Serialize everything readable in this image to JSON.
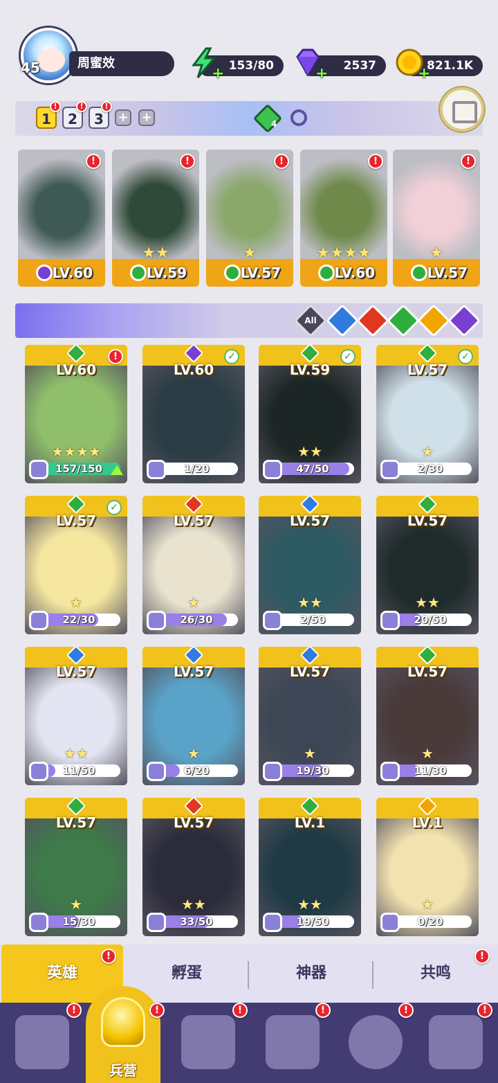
{
  "player": {
    "level": "45",
    "name": "周蜜效"
  },
  "resources": {
    "energy": "153/80",
    "gems": "2537",
    "gold": "821.1K"
  },
  "team_tabs": [
    {
      "label": "1",
      "active": true
    },
    {
      "label": "2",
      "active": false
    },
    {
      "label": "3",
      "active": false
    }
  ],
  "badge_mark": "!",
  "add_symbol": "+",
  "team_gem_count": "4",
  "team_heroes": [
    {
      "level": "LV.60",
      "element": "dark",
      "stars": "",
      "color": "#7a3fd0"
    },
    {
      "level": "LV.59",
      "element": "nature",
      "stars": "★★",
      "color": "#2fae3e"
    },
    {
      "level": "LV.57",
      "element": "nature",
      "stars": "★",
      "color": "#2fae3e"
    },
    {
      "level": "LV.60",
      "element": "nature",
      "stars": "★★★★",
      "color": "#2fae3e"
    },
    {
      "level": "LV.57",
      "element": "nature",
      "stars": "★",
      "color": "#2fae3e"
    }
  ],
  "filter": {
    "all_label": "All",
    "elements": [
      "water",
      "fire",
      "nature",
      "light",
      "dark"
    ]
  },
  "element_colors": {
    "water": "#2f7be0",
    "fire": "#e0381f",
    "nature": "#2fae3e",
    "light": "#f0a500",
    "dark": "#7a3fd0"
  },
  "heroes": [
    {
      "level": "LV.60",
      "element": "nature",
      "progress": "157/150",
      "stars": "★★★★",
      "status": "alert"
    },
    {
      "level": "LV.60",
      "element": "dark",
      "progress": "1/20",
      "stars": "",
      "status": "check"
    },
    {
      "level": "LV.59",
      "element": "nature",
      "progress": "47/50",
      "stars": "★★",
      "status": "check"
    },
    {
      "level": "LV.57",
      "element": "nature",
      "progress": "2/30",
      "stars": "★",
      "status": "check"
    },
    {
      "level": "LV.57",
      "element": "nature",
      "progress": "22/30",
      "stars": "★",
      "status": "check"
    },
    {
      "level": "LV.57",
      "element": "fire",
      "progress": "26/30",
      "stars": "★",
      "status": ""
    },
    {
      "level": "LV.57",
      "element": "water",
      "progress": "2/50",
      "stars": "★★",
      "status": ""
    },
    {
      "level": "LV.57",
      "element": "nature",
      "progress": "20/50",
      "stars": "★★",
      "status": ""
    },
    {
      "level": "LV.57",
      "element": "water",
      "progress": "11/50",
      "stars": "★★",
      "status": ""
    },
    {
      "level": "LV.57",
      "element": "water",
      "progress": "6/20",
      "stars": "★",
      "status": ""
    },
    {
      "level": "LV.57",
      "element": "water",
      "progress": "19/30",
      "stars": "★",
      "status": ""
    },
    {
      "level": "LV.57",
      "element": "nature",
      "progress": "11/30",
      "stars": "★",
      "status": ""
    },
    {
      "level": "LV.57",
      "element": "nature",
      "progress": "15/30",
      "stars": "★",
      "status": ""
    },
    {
      "level": "LV.57",
      "element": "fire",
      "progress": "33/50",
      "stars": "★★",
      "status": ""
    },
    {
      "level": "LV.1",
      "element": "nature",
      "progress": "19/50",
      "stars": "★★",
      "status": ""
    },
    {
      "level": "LV.1",
      "element": "light",
      "progress": "0/20",
      "stars": "★",
      "status": ""
    }
  ],
  "sub_tabs": [
    "英雄",
    "孵蛋",
    "神器",
    "共鸣"
  ],
  "nav": {
    "active_label": "兵营"
  }
}
